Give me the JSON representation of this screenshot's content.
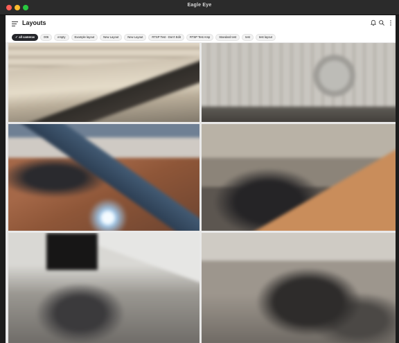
{
  "window": {
    "title": "Eagle Eye"
  },
  "header": {
    "title": "Layouts"
  },
  "layouts": [
    {
      "label": "all cameras",
      "selected": true
    },
    {
      "label": "006",
      "selected": false
    },
    {
      "label": "empty",
      "selected": false
    },
    {
      "label": "Example layout",
      "selected": false
    },
    {
      "label": "New Layout",
      "selected": false
    },
    {
      "label": "New Layout",
      "selected": false
    },
    {
      "label": "RTSP Test - Don't Edit",
      "selected": false
    },
    {
      "label": "RTSP Test Amp",
      "selected": false
    },
    {
      "label": "Standard test",
      "selected": false
    },
    {
      "label": "test",
      "selected": false
    },
    {
      "label": "test layout",
      "selected": false
    }
  ],
  "icons": {
    "menu": "hamburger-menu-icon",
    "notifications": "bell-icon",
    "search": "search-icon",
    "more": "more-vertical-icon",
    "selected": "check-icon"
  },
  "colors": {
    "chip_active": "#25262b",
    "titlebar": "#2b2b2b"
  }
}
